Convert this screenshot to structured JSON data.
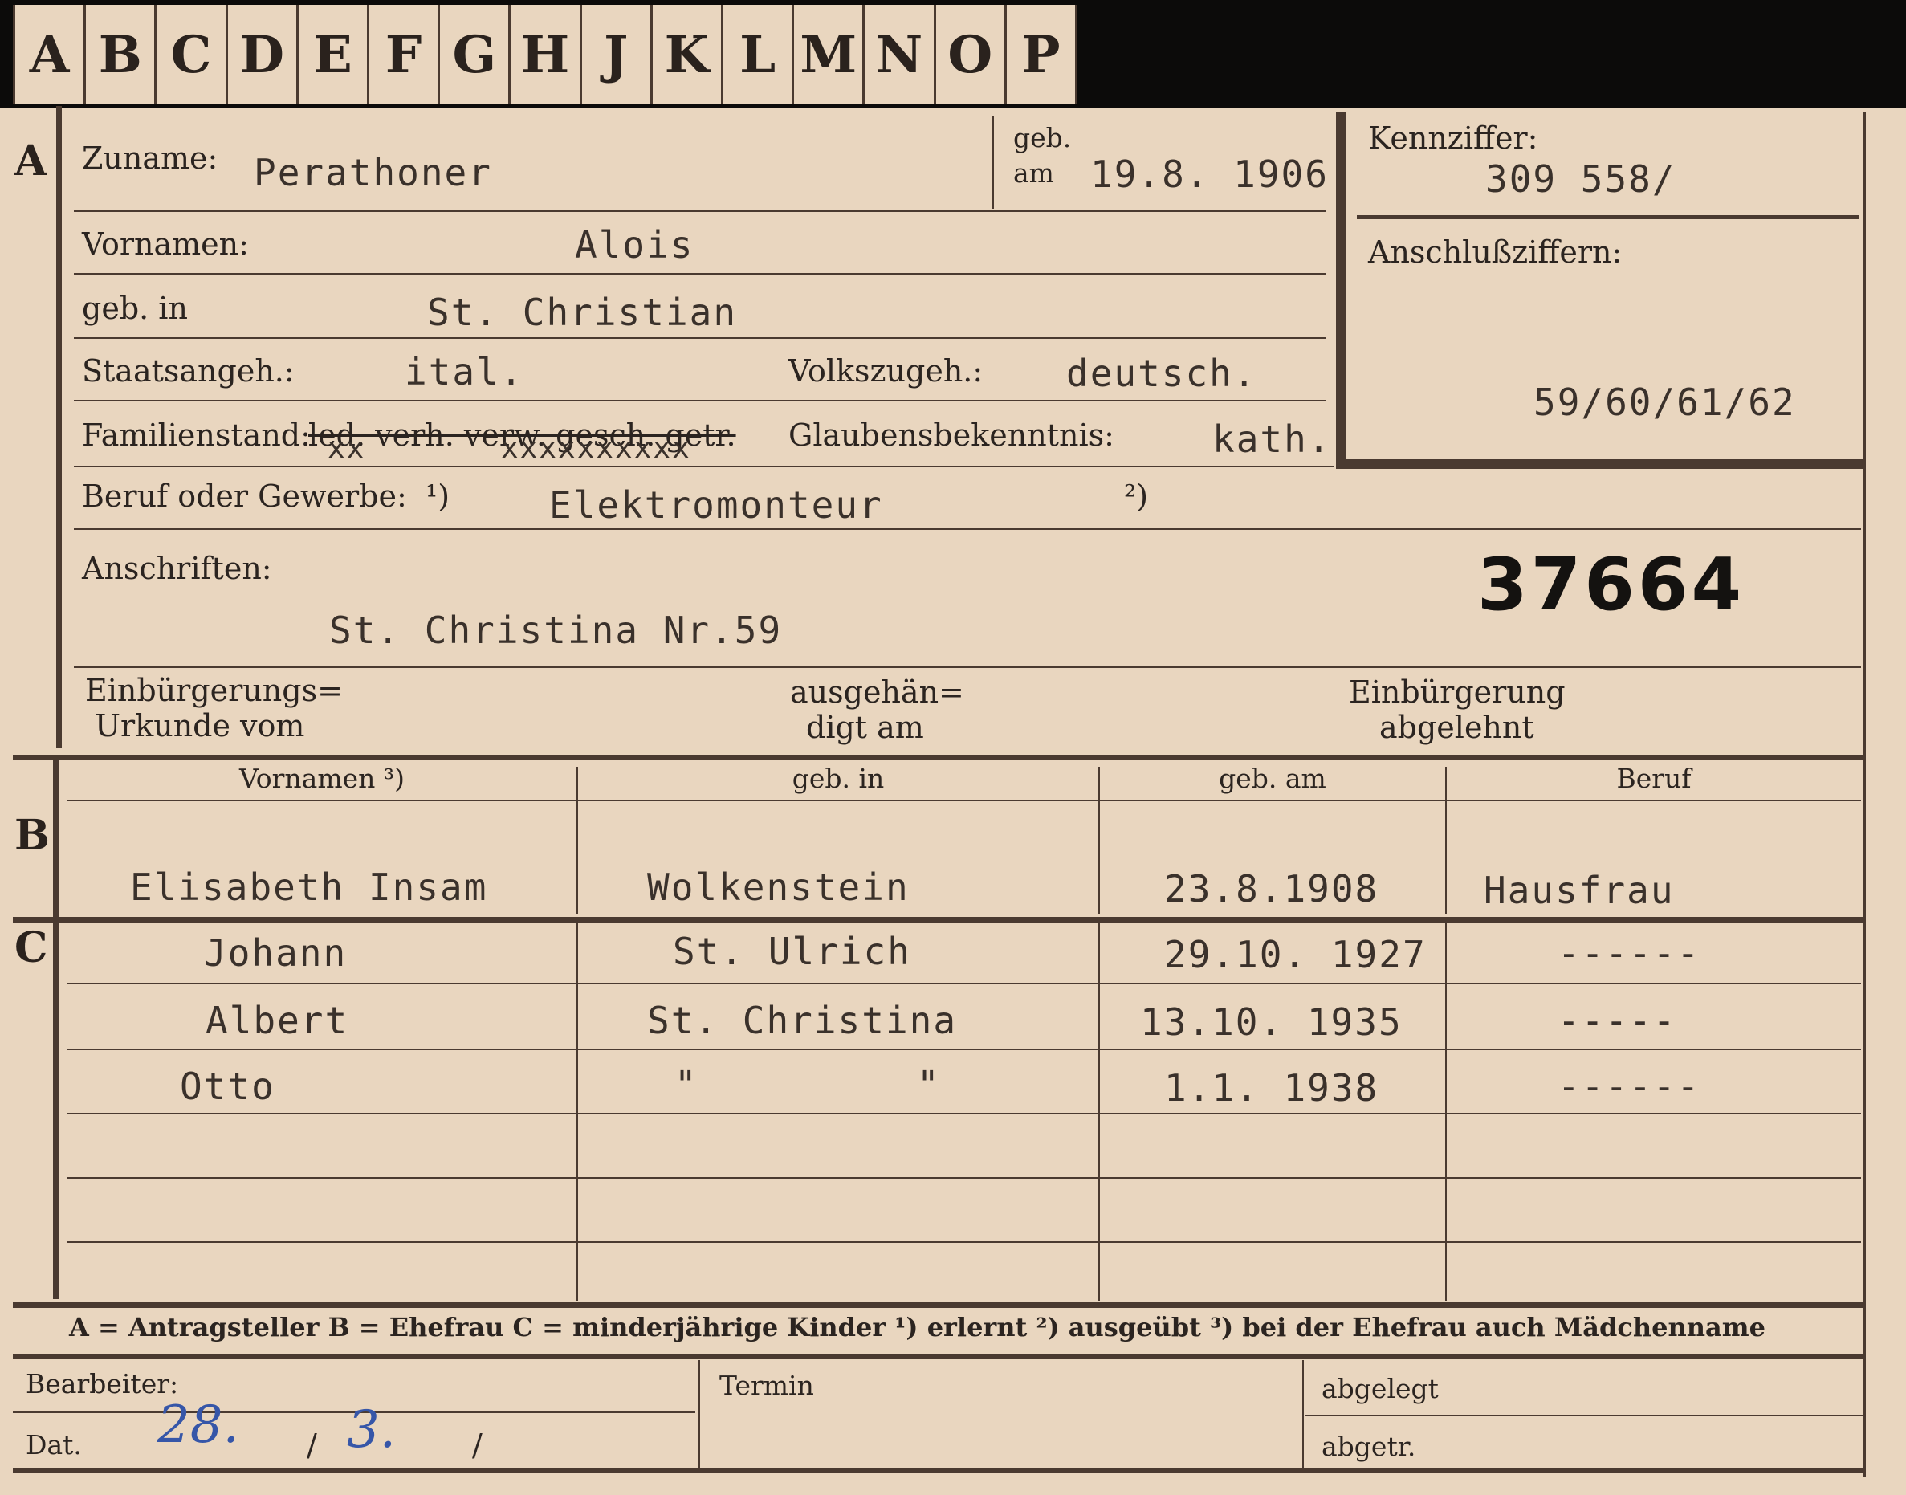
{
  "tabs": [
    "A",
    "B",
    "C",
    "D",
    "E",
    "F",
    "G",
    "H",
    "J",
    "K",
    "L",
    "M",
    "N",
    "O",
    "P"
  ],
  "sections": {
    "a": "A",
    "b": "B",
    "c": "C"
  },
  "labels": {
    "zuname": "Zuname:",
    "geb_top": "geb.",
    "am": "am",
    "kennziffer": "Kennziffer:",
    "vornamen": "Vornamen:",
    "anschlussziffern": "Anschlußziffern:",
    "geb_in": "geb. in",
    "staatsangeh": "Staatsangeh.:",
    "volkszugeh": "Volkszugeh.:",
    "familienstand": "Familienstand:",
    "familienstand_options": "led. verh. verw. gesch. getr.",
    "glaubensbekenntnis": "Glaubensbekenntnis:",
    "beruf": "Beruf oder Gewerbe:",
    "note1": "¹)",
    "note2": "²)",
    "anschriften": "Anschriften:",
    "einb_urkunde_1": "Einbürgerungs=",
    "einb_urkunde_2": "Urkunde vom",
    "ausgehaendigt_1": "ausgehän=",
    "ausgehaendigt_2": "digt am",
    "einb_abgelehnt_1": "Einbürgerung",
    "einb_abgelehnt_2": "abgelehnt"
  },
  "applicant": {
    "zuname": "Perathoner",
    "geb_am": "19.8. 1906",
    "kennziffer": "309 558/",
    "vornamen": "Alois",
    "geb_in": "St. Christian",
    "staatsangeh": "ital.",
    "volkszugeh": "deutsch.",
    "glaubensbekenntnis": "kath.",
    "beruf": "Elektromonteur",
    "anschluss": "59/60/61/62",
    "anschrift": "St. Christina Nr.59",
    "stamp_number": "37664",
    "strike_marks_1": "xx",
    "strike_marks_2": "xxxxxxxxxx"
  },
  "table_headers": {
    "vornamen": "Vornamen ³)",
    "geb_in": "geb. in",
    "geb_am": "geb. am",
    "beruf": "Beruf"
  },
  "spouse": {
    "name": "Elisabeth Insam",
    "geb_in": "Wolkenstein",
    "geb_am": "23.8.1908",
    "beruf": "Hausfrau"
  },
  "children": [
    {
      "name": "Johann",
      "geb_in": "St. Ulrich",
      "geb_am": "29.10. 1927",
      "beruf": "------"
    },
    {
      "name": "Albert",
      "geb_in": "St. Christina",
      "geb_am": "13.10. 1935",
      "beruf": "-----"
    },
    {
      "name": "Otto",
      "geb_in": "\"",
      "geb_in_2": "\"",
      "geb_am": "1.1. 1938",
      "beruf": "------"
    }
  ],
  "legend": "A = Antragsteller   B = Ehefrau   C = minderjährige Kinder   ¹) erlernt   ²) ausgeübt   ³) bei der Ehefrau auch Mädchenname",
  "footer": {
    "bearbeiter": "Bearbeiter:",
    "dat": "Dat.",
    "dat_hand_1": "28.",
    "dat_hand_2": "3.",
    "slash": "/",
    "termin": "Termin",
    "abgelegt": "abgelegt",
    "abgetr": "abgetr."
  }
}
